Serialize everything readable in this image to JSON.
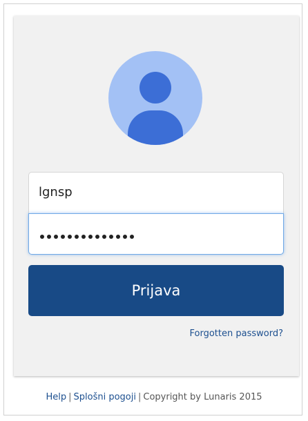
{
  "login": {
    "username_value": "lgnsp",
    "password_masked": "••••••••••••••",
    "submit_label": "Prijava",
    "forgot_label": "Forgotten password?"
  },
  "avatar": {
    "icon": "user-avatar-icon"
  },
  "footer": {
    "help_label": "Help",
    "separator": "|",
    "terms_label": "Splošni pogoji",
    "copyright": "Copyright by Lunaris 2015"
  },
  "colors": {
    "button": "#184a86",
    "avatar_bg": "#a3c1f5",
    "avatar_fg": "#3c6ed6",
    "card_bg": "#f1f1f1",
    "link": "#1c4f8f"
  }
}
